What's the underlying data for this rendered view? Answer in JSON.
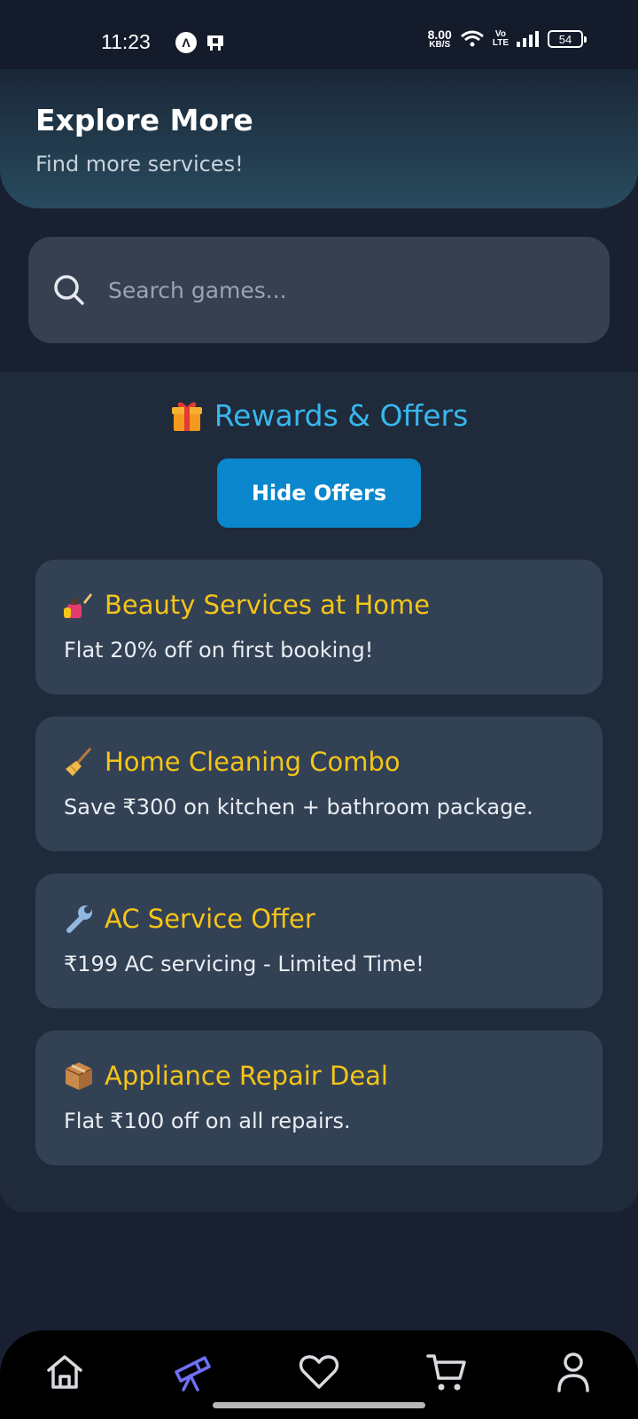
{
  "status_bar": {
    "time": "11:23",
    "net_speed_value": "8.00",
    "net_speed_unit": "KB/S",
    "volte_top": "Vo",
    "volte_bottom": "LTE",
    "battery": "54"
  },
  "header": {
    "title": "Explore More",
    "subtitle": "Find more services!"
  },
  "search": {
    "placeholder": "Search games..."
  },
  "rewards": {
    "title": "Rewards & Offers",
    "hide_button_label": "Hide Offers",
    "offers": [
      {
        "icon": "nail-polish-icon",
        "title": "Beauty Services at Home",
        "description": "Flat 20% off on first booking!"
      },
      {
        "icon": "broom-icon",
        "title": "Home Cleaning Combo",
        "description": "Save ₹300 on kitchen + bathroom package."
      },
      {
        "icon": "wrench-icon",
        "title": "AC Service Offer",
        "description": "₹199 AC servicing - Limited Time!"
      },
      {
        "icon": "package-icon",
        "title": "Appliance Repair Deal",
        "description": "Flat ₹100 off on all repairs."
      }
    ]
  },
  "bottom_nav": {
    "items": [
      {
        "icon": "home-icon",
        "active": false
      },
      {
        "icon": "telescope-icon",
        "active": true
      },
      {
        "icon": "heart-icon",
        "active": false
      },
      {
        "icon": "cart-icon",
        "active": false
      },
      {
        "icon": "profile-icon",
        "active": false
      }
    ]
  },
  "colors": {
    "background": "#182031",
    "accent_blue": "#38b7ee",
    "button_blue": "#0a87cc",
    "offer_title": "#f5c518",
    "active_nav": "#6f6ff7"
  }
}
